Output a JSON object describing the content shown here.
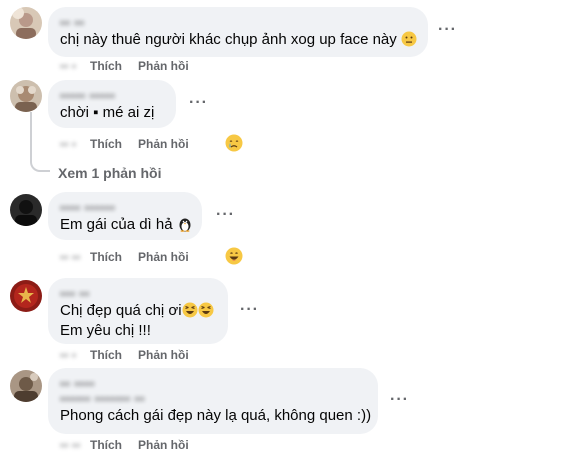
{
  "actions": {
    "like": "Thích",
    "reply": "Phản hồi"
  },
  "comments": [
    {
      "name": "▪▪ ▪▪",
      "text": "chị này thuê người khác chụp ảnh xog up face này",
      "time": "▪▪ ▪",
      "emoji_after": "neutral-face-emoji"
    },
    {
      "name": "▪▪▪▪▪ ▪▪▪▪▪",
      "text": "chời ▪ mé ai zị",
      "time": "▪▪ ▪",
      "reaction": "crying-face-reaction",
      "view_replies": "Xem 1 phản hồi"
    },
    {
      "name": "▪▪▪▪ ▪▪▪▪▪▪",
      "text": "Em gái của dì hả",
      "time": "▪▪ ▪▪",
      "emoji_after": "penguin-emoji",
      "reaction": "grinning-face-reaction"
    },
    {
      "name": "▪▪▪ ▪▪",
      "text_lines": [
        "Chị đẹp quá chị ơi",
        "Em yêu chị !!!"
      ],
      "time": "▪▪ ▪",
      "emoji_after": "laughing-face-emoji"
    },
    {
      "name_lines": [
        "▪▪ ▪▪▪▪",
        "▪▪▪▪▪▪ ▪▪▪▪▪▪▪ ▪▪"
      ],
      "text": "Phong cách gái đẹp này lạ quá, không quen :))",
      "time": "▪▪ ▪▪"
    }
  ],
  "icons": {
    "more": "more-options-icon",
    "avatar": "avatar"
  }
}
